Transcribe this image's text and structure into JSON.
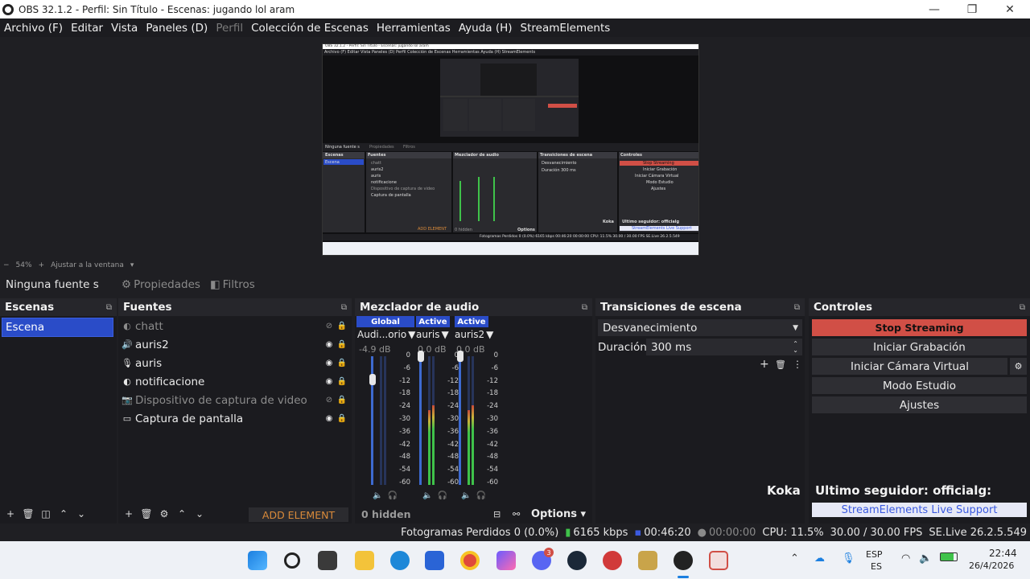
{
  "window": {
    "title": "OBS 32.1.2 - Perfil: Sin Título - Escenas: jugando lol aram",
    "minimize_glyph": "—",
    "maximize_glyph": "❐",
    "close_glyph": "✕"
  },
  "menu": [
    "Archivo (F)",
    "Editar",
    "Vista",
    "Paneles (D)",
    "Perfil",
    "Colección de Escenas",
    "Herramientas",
    "Ayuda (H)",
    "StreamElements"
  ],
  "preview": {
    "zoom": "54%",
    "zoom_minus": "−",
    "zoom_plus": "+",
    "fit_label": "Ajustar a la ventana"
  },
  "source_toolbar": {
    "no_source": "Ninguna fuente s",
    "properties": "Propiedades",
    "filters": "Filtros"
  },
  "scenes": {
    "title": "Escenas",
    "items": [
      "Escena"
    ]
  },
  "sources": {
    "title": "Fuentes",
    "items": [
      {
        "name": "chatt",
        "icon": "browser-icon"
      },
      {
        "name": "auris2",
        "icon": "speaker-icon"
      },
      {
        "name": "auris",
        "icon": "microphone-icon"
      },
      {
        "name": "notificacione",
        "icon": "browser-icon"
      },
      {
        "name": "Dispositivo de captura de video",
        "icon": "camera-icon"
      },
      {
        "name": "Captura de pantalla",
        "icon": "monitor-icon"
      }
    ],
    "add_element": "ADD ELEMENT"
  },
  "mixer": {
    "title": "Mezclador de audio",
    "channels": [
      {
        "badge": "Global",
        "name": "Audi...orio",
        "db": "-4.9 dB",
        "level": 0.82
      },
      {
        "badge": "Active",
        "name": "auris",
        "db": "0.0 dB",
        "level": 1.0
      },
      {
        "badge": "Active",
        "name": "auris2",
        "db": "0.0 dB",
        "level": 1.0
      }
    ],
    "ticks": [
      "0",
      "-6",
      "-12",
      "-18",
      "-24",
      "-30",
      "-36",
      "-42",
      "-48",
      "-54",
      "-60"
    ],
    "hidden": "0 hidden",
    "options": "Options"
  },
  "transitions": {
    "title": "Transiciones de escena",
    "selected": "Desvanecimiento",
    "duration_label": "Duración",
    "duration_value": "300 ms"
  },
  "controls": {
    "title": "Controles",
    "stop_streaming": "Stop Streaming",
    "start_recording": "Iniciar Grabación",
    "start_virtual_cam": "Iniciar Cámara Virtual",
    "studio_mode": "Modo Estudio",
    "settings": "Ajustes"
  },
  "streamelements": {
    "user": "Koka",
    "last_follower": "Ultimo seguidor: officialg:",
    "support": "StreamElements Live Support"
  },
  "status": {
    "dropped": "Fotogramas Perdidos 0 (0.0%)",
    "bitrate": "6165 kbps",
    "stream_time": "00:46:20",
    "rec_time": "00:00:00",
    "cpu": "CPU: 11.5%",
    "fps": "30.00 / 30.00 FPS",
    "se_version": "SE.Live 26.2.5.549"
  },
  "taskbar": {
    "lang_top": "ESP",
    "lang_bottom": "ES",
    "time": "22:44",
    "date": "26/4/2026",
    "discord_badge": "3"
  },
  "preview_mini": {
    "title": "OBS 32.1.2 - Perfil: Sin Título - Escenas: jugando lol aram",
    "menu": "Archivo (F)  Editar  Vista  Paneles (D)  Perfil  Colección de Escenas  Herramientas  Ayuda (H)  StreamElements",
    "no_source": "Ninguna fuente s",
    "properties": "Propiedades",
    "filters": "Filtros",
    "scenes_title": "Escenas",
    "scene": "Escena",
    "sources_title": "Fuentes",
    "sources": [
      "chatt",
      "auris2",
      "auris",
      "notificacione",
      "Dispositivo de captura de video",
      "Captura de pantalla"
    ],
    "mixer_title": "Mezclador de audio",
    "transitions_title": "Transiciones de escena",
    "transition": "Desvanecimiento",
    "duration_label": "Duración",
    "duration_value": "300 ms",
    "controls_title": "Controles",
    "controls": [
      "Stop Streaming",
      "Iniciar Grabación",
      "Iniciar Cámara Virtual",
      "Modo Estudio",
      "Ajustes"
    ],
    "koka": "Koka",
    "follower": "Ultimo seguidor: officialg",
    "support": "StreamElements Live Support",
    "add_element": "ADD ELEMENT",
    "hidden": "0 hidden",
    "options": "Options",
    "status": "Fotogramas Perdidos 0 (0.0%)   6165 kbps   00:46:20   00:00:00   CPU: 11.5%   30.00 / 30.00 FPS   SE.Live 26.2.5.549"
  },
  "colors": {
    "accent_blue": "#2a4cc8",
    "stop_red": "#d14f46",
    "add_element_orange": "#d98a3a",
    "meter_green": "#3fc24a"
  }
}
